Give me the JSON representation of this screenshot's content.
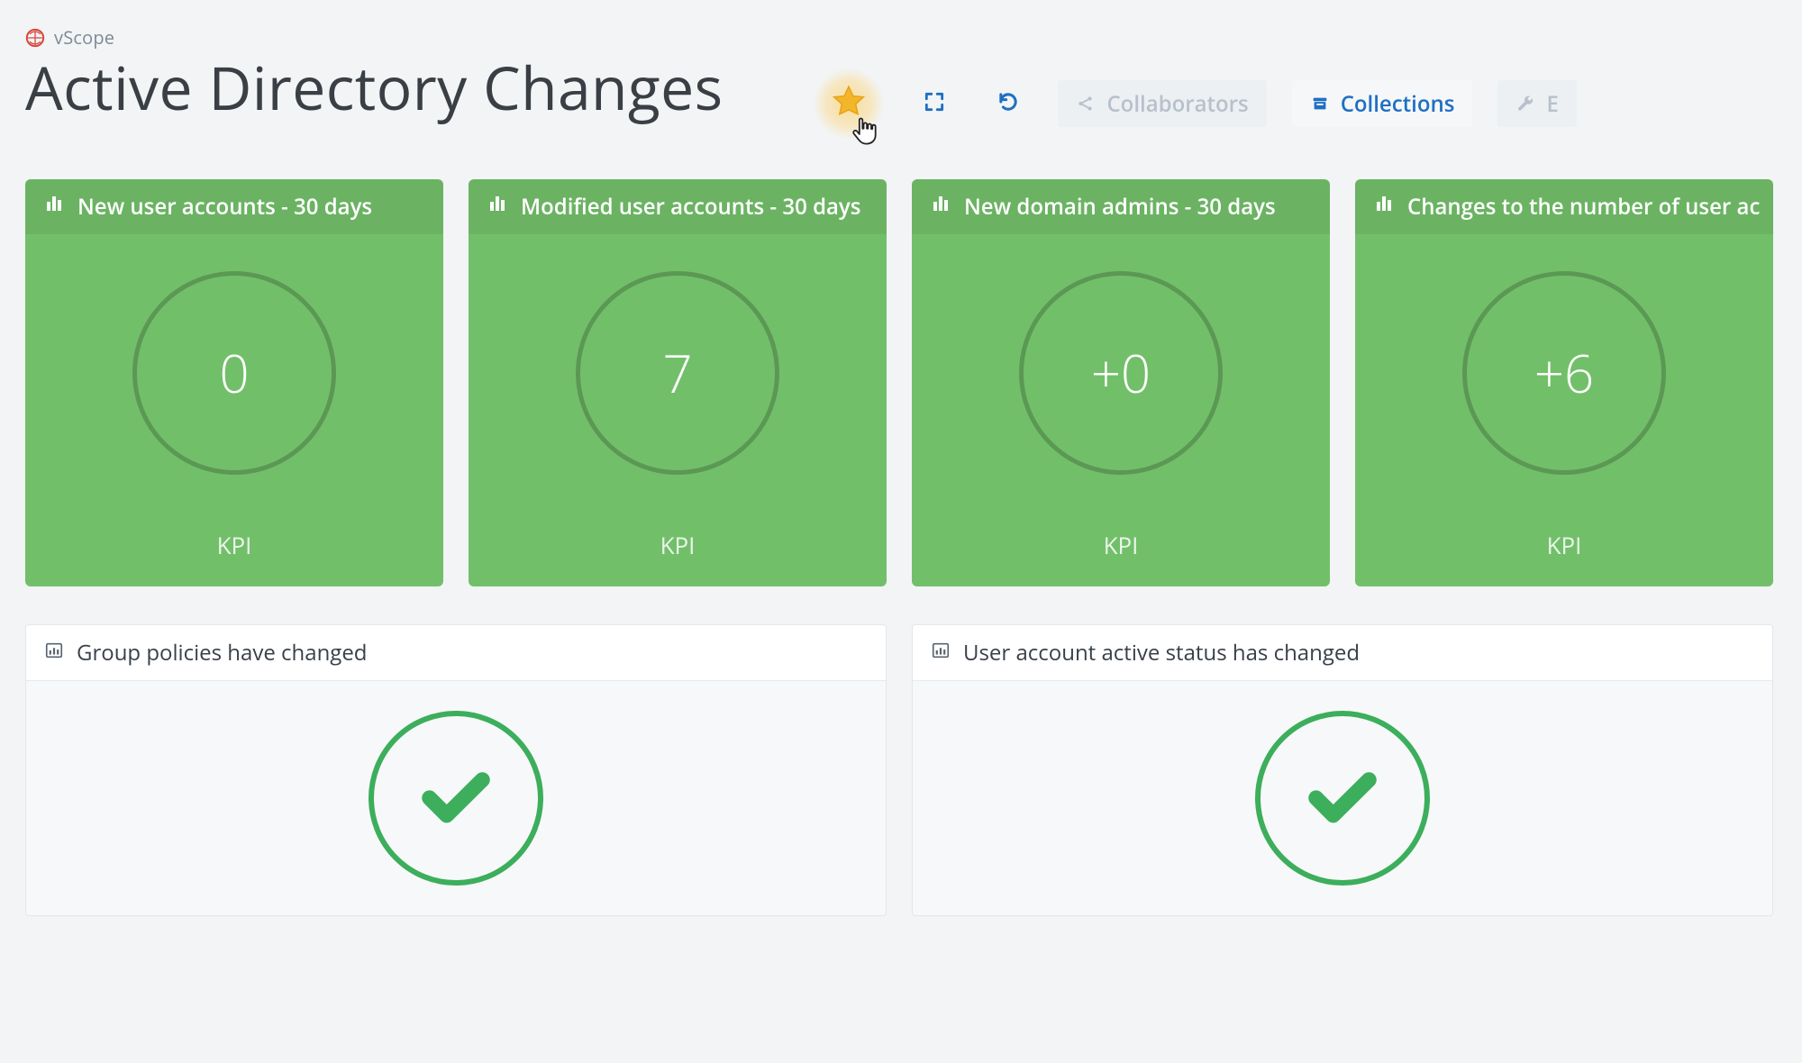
{
  "brand": {
    "name": "vScope"
  },
  "header": {
    "title": "Active Directory Changes",
    "toolbar": {
      "collaborators_label": "Collaborators",
      "collections_label": "Collections",
      "edit_partial": "E"
    }
  },
  "colors": {
    "kpi_bg": "#72bf6a",
    "accent_blue": "#1f6fc2",
    "check_green": "#3cae5c",
    "star_yellow": "#f2b21f"
  },
  "kpis": [
    {
      "title": "New user accounts - 30 days",
      "value": "0",
      "footer": "KPI"
    },
    {
      "title": "Modified user accounts - 30 days",
      "value": "7",
      "footer": "KPI"
    },
    {
      "title": "New domain admins - 30 days",
      "value": "+0",
      "footer": "KPI"
    },
    {
      "title": "Changes to the number of user ac",
      "value": "+6",
      "footer": "KPI"
    }
  ],
  "panels": [
    {
      "title": "Group policies have changed"
    },
    {
      "title": "User account active status has changed"
    }
  ]
}
